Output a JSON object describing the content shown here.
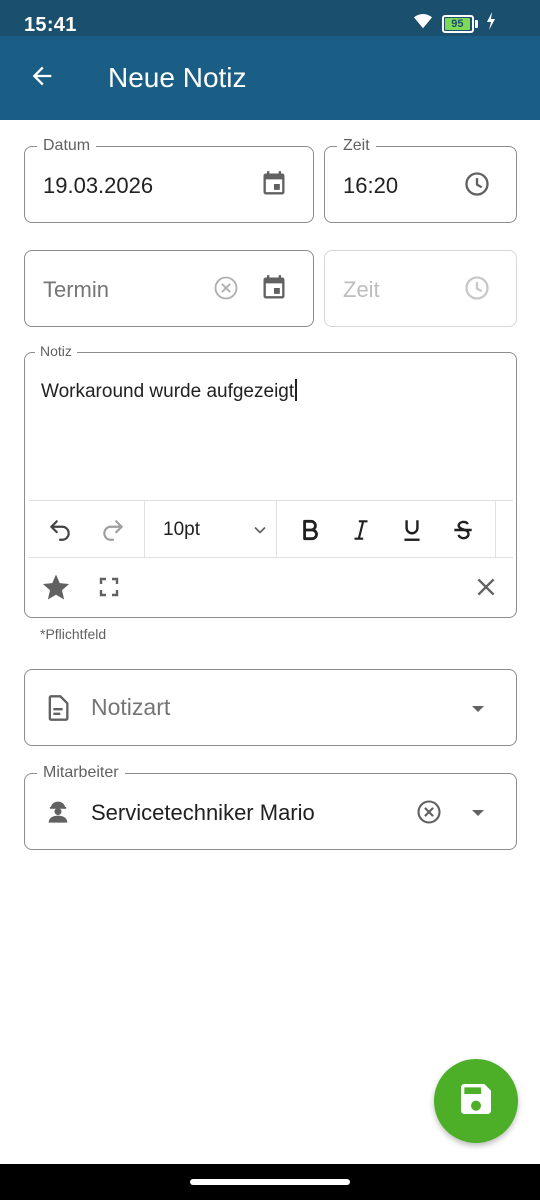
{
  "status_bar": {
    "time": "15:41",
    "battery": "95"
  },
  "app_bar": {
    "title": "Neue Notiz"
  },
  "form": {
    "datum": {
      "label": "Datum",
      "value": "19.03.2026"
    },
    "zeit": {
      "label": "Zeit",
      "value": "16:20"
    },
    "termin": {
      "placeholder": "Termin"
    },
    "termin_zeit": {
      "placeholder": "Zeit"
    },
    "notiz": {
      "label": "Notiz",
      "text": "Workaround wurde aufgezeigt",
      "font_size": "10pt",
      "helper": "*Pflichtfeld"
    },
    "notizart": {
      "placeholder": "Notizart"
    },
    "mitarbeiter": {
      "label": "Mitarbeiter",
      "value": "Servicetechniker Mario"
    }
  },
  "colors": {
    "app_bar": "#1b5e85",
    "status_bar": "#1b4f6e",
    "fab": "#4caf27",
    "icon": "#616161"
  }
}
